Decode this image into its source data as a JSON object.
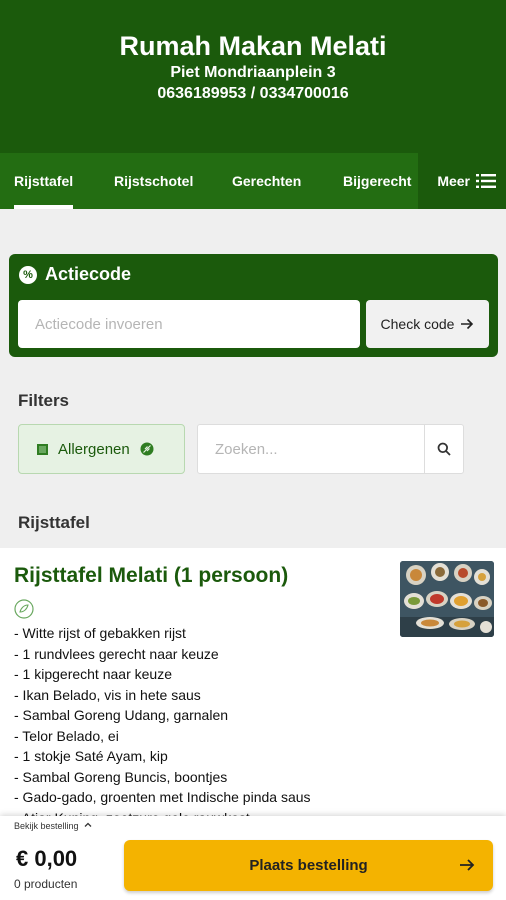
{
  "restaurant": {
    "name": "Rumah Makan Melati",
    "address": "Piet Mondriaanplein 3",
    "phones": "0636189953 / 0334700016"
  },
  "tabs": [
    {
      "label": "Rijsttafel",
      "active": true
    },
    {
      "label": "Rijstschotel",
      "active": false
    },
    {
      "label": "Gerechten",
      "active": false
    },
    {
      "label": "Bijgerecht",
      "active": false
    }
  ],
  "more_label": "Meer",
  "promo": {
    "title": "Actiecode",
    "icon": "percent-icon",
    "placeholder": "Actiecode invoeren",
    "button_label": "Check code"
  },
  "filters": {
    "heading": "Filters",
    "allergens_label": "Allergenen",
    "search_placeholder": "Zoeken..."
  },
  "category_heading": "Rijsttafel",
  "product": {
    "title": "Rijsttafel Melati (1 persoon)",
    "description": [
      "- Witte rijst of gebakken rijst",
      "- 1 rundvlees gerecht naar keuze",
      "- 1 kipgerecht naar keuze",
      "- Ikan Belado, vis in hete saus",
      "- Sambal Goreng Udang, garnalen",
      "- Telor Belado, ei",
      "- 1 stokje Saté Ayam, kip",
      "- Sambal Goreng Buncis, boontjes",
      "- Gado-gado, groenten met Indische pinda saus",
      "- Atjar Kuning, zoetzure gele rauwkost"
    ]
  },
  "order": {
    "toggle_label": "Bekijk bestelling",
    "total": "€ 0,00",
    "count": "0 producten",
    "button_label": "Plaats bestelling"
  },
  "colors": {
    "brand_green": "#1b5a0c",
    "accent_yellow": "#f4b300"
  }
}
